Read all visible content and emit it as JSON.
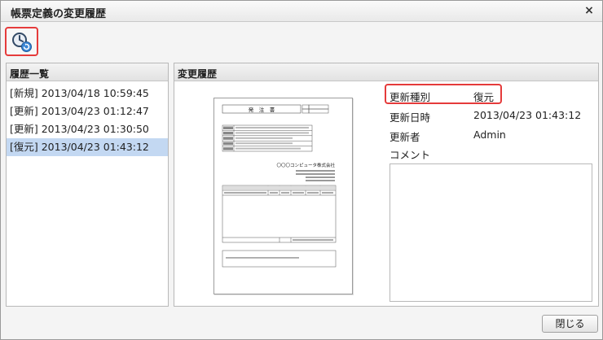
{
  "dialog": {
    "title": "帳票定義の変更履歴",
    "close_glyph": "×"
  },
  "toolbar": {
    "restore_icon": "clock-restore-icon"
  },
  "history": {
    "header": "履歴一覧",
    "items": [
      "[新規] 2013/04/18 10:59:45",
      "[更新] 2013/04/23 01:12:47",
      "[更新] 2013/04/23 01:30:50",
      "[復元] 2013/04/23 01:43:12"
    ],
    "selected_index": 3
  },
  "details": {
    "header": "変更履歴",
    "update_type_label": "更新種別",
    "update_type_value": "復元",
    "update_datetime_label": "更新日時",
    "update_datetime_value": "2013/04/23 01:43:12",
    "updated_by_label": "更新者",
    "updated_by_value": "Admin",
    "comment_label": "コメント",
    "comment_value": ""
  },
  "preview": {
    "doc_title": "発　注　書",
    "company_name": "〇〇〇コンピュータ株式会社"
  },
  "footer": {
    "close_label": "閉じる"
  },
  "colors": {
    "highlight": "#e53b3b",
    "selection": "#c3d8f2"
  }
}
